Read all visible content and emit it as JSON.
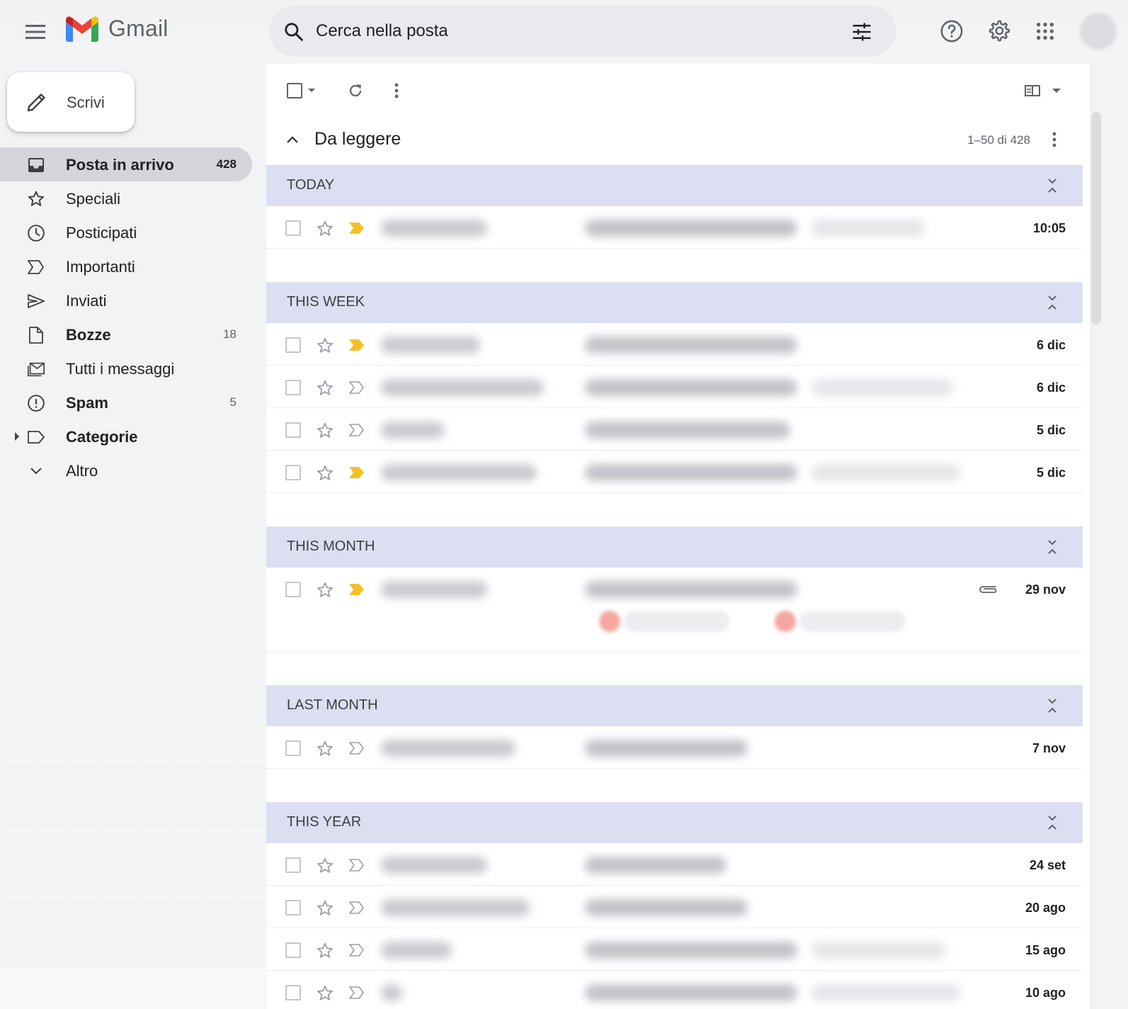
{
  "app": {
    "name": "Gmail",
    "brand_colors": {
      "red": "#ea4335",
      "blue": "#4285f4",
      "yellow": "#fbbc04",
      "green": "#34a853"
    }
  },
  "search": {
    "placeholder": "Cerca nella posta",
    "value": ""
  },
  "compose": {
    "label": "Scrivi"
  },
  "sidebar": {
    "items": [
      {
        "label": "Posta in arrivo",
        "count": "428",
        "icon": "inbox-icon",
        "active": true,
        "bold": true
      },
      {
        "label": "Speciali",
        "count": "",
        "icon": "star-icon",
        "active": false,
        "bold": false
      },
      {
        "label": "Posticipati",
        "count": "",
        "icon": "clock-icon",
        "active": false,
        "bold": false
      },
      {
        "label": "Importanti",
        "count": "",
        "icon": "important-icon",
        "active": false,
        "bold": false
      },
      {
        "label": "Inviati",
        "count": "",
        "icon": "send-icon",
        "active": false,
        "bold": false
      },
      {
        "label": "Bozze",
        "count": "18",
        "icon": "draft-icon",
        "active": false,
        "bold": true
      },
      {
        "label": "Tutti i messaggi",
        "count": "",
        "icon": "all-mail-icon",
        "active": false,
        "bold": false
      },
      {
        "label": "Spam",
        "count": "5",
        "icon": "spam-icon",
        "active": false,
        "bold": true
      },
      {
        "label": "Categorie",
        "count": "",
        "icon": "label-icon",
        "active": false,
        "bold": true
      },
      {
        "label": "Altro",
        "count": "",
        "icon": "chevron-down-icon",
        "active": false,
        "bold": false
      }
    ]
  },
  "mail_section": {
    "title": "Da leggere",
    "range": "1–50 di 428"
  },
  "groups": [
    {
      "label": "TODAY",
      "rows": [
        {
          "date": "10:05",
          "important": true
        }
      ]
    },
    {
      "label": "THIS WEEK",
      "rows": [
        {
          "date": "6 dic",
          "important": true
        },
        {
          "date": "6 dic",
          "important": false
        },
        {
          "date": "5 dic",
          "important": false
        },
        {
          "date": "5 dic",
          "important": true
        }
      ]
    },
    {
      "label": "THIS MONTH",
      "rows": [
        {
          "date": "29 nov",
          "important": true,
          "attachment": true
        }
      ]
    },
    {
      "label": "LAST MONTH",
      "rows": [
        {
          "date": "7 nov",
          "important": false
        }
      ]
    },
    {
      "label": "THIS YEAR",
      "rows": [
        {
          "date": "24 set",
          "important": false
        },
        {
          "date": "20 ago",
          "important": false
        },
        {
          "date": "15 ago",
          "important": false
        },
        {
          "date": "10 ago",
          "important": false
        }
      ]
    }
  ]
}
